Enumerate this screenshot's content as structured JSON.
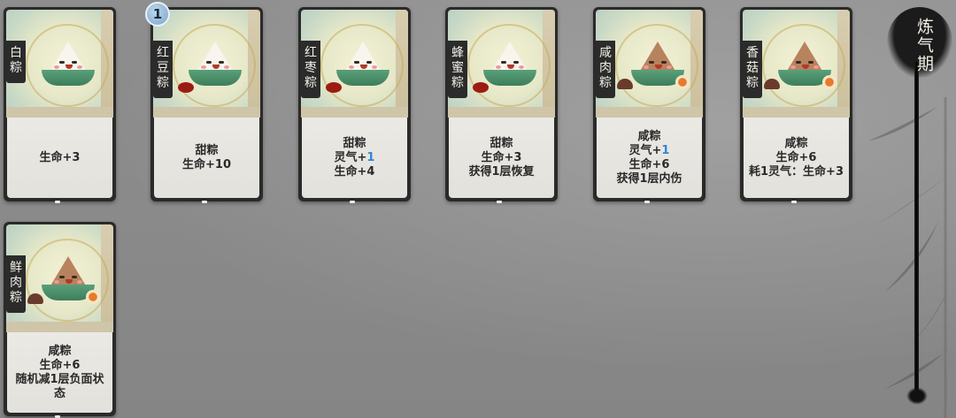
{
  "realm": {
    "label": "炼气期"
  },
  "cards": [
    {
      "id": "bai",
      "name": "白粽",
      "desc": [
        {
          "text": "生命+3"
        }
      ],
      "badge": "",
      "style": "white"
    },
    {
      "id": "hongdou",
      "name": "红豆粽",
      "desc": [
        {
          "text": "甜粽"
        },
        {
          "text": "生命+10"
        }
      ],
      "badge": "1",
      "style": "bean"
    },
    {
      "id": "hongzao",
      "name": "红枣粽",
      "desc": [
        {
          "text": "甜粽"
        },
        {
          "pre": "灵气+",
          "blue": "1"
        },
        {
          "text": "生命+4"
        }
      ],
      "badge": "",
      "style": "bean"
    },
    {
      "id": "fengmi",
      "name": "蜂蜜粽",
      "desc": [
        {
          "text": "甜粽"
        },
        {
          "text": "生命+3"
        },
        {
          "text": "获得1层恢复"
        }
      ],
      "badge": "",
      "style": "bean"
    },
    {
      "id": "xianrou",
      "name": "咸肉粽",
      "desc": [
        {
          "text": "咸粽"
        },
        {
          "pre": "灵气+",
          "blue": "1"
        },
        {
          "text": "生命+6"
        },
        {
          "text": "获得1层内伤"
        }
      ],
      "badge": "",
      "style": "meat"
    },
    {
      "id": "xianggu",
      "name": "香菇粽",
      "desc": [
        {
          "text": "咸粽"
        },
        {
          "text": "生命+6"
        },
        {
          "text": "耗1灵气：生命+3",
          "wrap": true
        }
      ],
      "badge": "",
      "style": "meat"
    },
    {
      "id": "xianrou2",
      "name": "鲜肉粽",
      "desc": [
        {
          "text": "咸粽"
        },
        {
          "text": "生命+6"
        },
        {
          "text": "随机减1层负面状态",
          "wrap": true
        }
      ],
      "badge": "",
      "style": "meat"
    }
  ]
}
